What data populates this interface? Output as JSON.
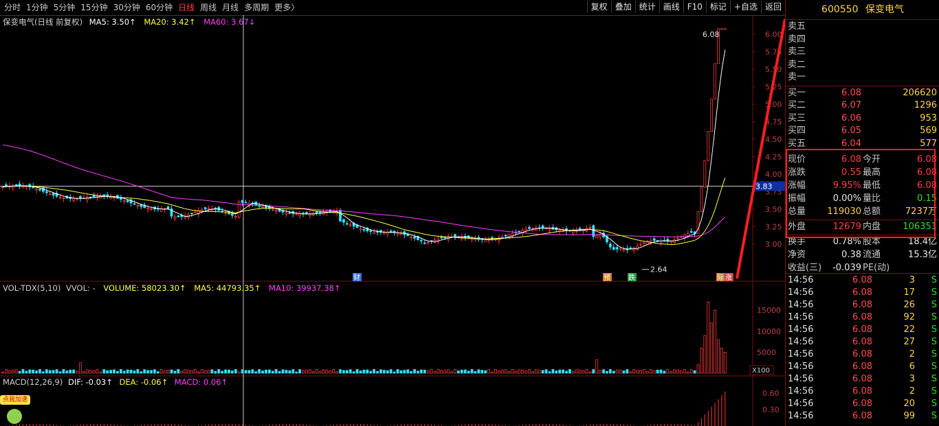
{
  "toolbar": {
    "periods": [
      "分时",
      "1分钟",
      "5分钟",
      "15分钟",
      "30分钟",
      "60分钟",
      "日线",
      "周线",
      "月线",
      "多周期",
      "更多〉"
    ],
    "active_index": 6,
    "tools": [
      "复权",
      "叠加",
      "统计",
      "画线",
      "F10",
      "标记",
      "+自选",
      "返回"
    ]
  },
  "legend_main": {
    "name": "保变电气(日线 前复权)",
    "ma5": "MA5: 3.50↑",
    "ma20": "MA20: 3.42↑",
    "ma60": "MA60: 3.67↓"
  },
  "legend_vol": {
    "name": "VOL-TDX(5,10)",
    "vvol": "VVOL: -",
    "volume": "VOLUME: 58023.30↑",
    "ma5": "MA5: 44793.35↑",
    "ma10": "MA10: 39937.38↑"
  },
  "legend_macd": {
    "name": "MACD(12,26,9)",
    "dif": "DIF: -0.03↑",
    "dea": "DEA: -0.06↑",
    "macd": "MACD: 0.06↑"
  },
  "price_axis": [
    "6.00",
    "5.75",
    "5.50",
    "5.25",
    "5.00",
    "4.75",
    "4.50",
    "4.25",
    "4.00",
    "3.75",
    "3.50",
    "3.25",
    "3.00"
  ],
  "crosshair_price": "3.83",
  "vol_axis": [
    "15000",
    "10000",
    "5000"
  ],
  "vol_unit": "X100",
  "macd_axis": [
    "0.60",
    "0.30"
  ],
  "annotations": {
    "high": "6.08",
    "low": "2.64",
    "markers": [
      "财",
      "预",
      "跌",
      "际",
      "涨"
    ]
  },
  "speed_button": "点我加速",
  "colors": {
    "up": "#ff3b3b",
    "down": "#33e0ff",
    "ma5": "#ffffff",
    "ma20": "#ffff40",
    "ma60": "#ff40ff",
    "panel_border": "#7a1010",
    "highlight_box": "#ff2020"
  },
  "panel": {
    "code": "600550",
    "name": "保变电气",
    "sells": [
      {
        "label": "卖五",
        "price": "",
        "vol": ""
      },
      {
        "label": "卖四",
        "price": "",
        "vol": ""
      },
      {
        "label": "卖三",
        "price": "",
        "vol": ""
      },
      {
        "label": "卖二",
        "price": "",
        "vol": ""
      },
      {
        "label": "卖一",
        "price": "",
        "vol": ""
      }
    ],
    "buys": [
      {
        "label": "买一",
        "price": "6.08",
        "vol": "206620"
      },
      {
        "label": "买二",
        "price": "6.07",
        "vol": "1296"
      },
      {
        "label": "买三",
        "price": "6.06",
        "vol": "953"
      },
      {
        "label": "买四",
        "price": "6.05",
        "vol": "569"
      },
      {
        "label": "买五",
        "price": "6.04",
        "vol": "577"
      }
    ],
    "quotes": [
      {
        "l1": "现价",
        "v1": "6.08",
        "c1": "red",
        "l2": "今开",
        "v2": "6.08",
        "c2": "red"
      },
      {
        "l1": "涨跌",
        "v1": "0.55",
        "c1": "red",
        "l2": "最高",
        "v2": "6.08",
        "c2": "red"
      },
      {
        "l1": "涨幅",
        "v1": "9.95%",
        "c1": "red",
        "l2": "最低",
        "v2": "6.08",
        "c2": "red"
      },
      {
        "l1": "振幅",
        "v1": "0.00%",
        "c1": "white",
        "l2": "量比",
        "v2": "0.15",
        "c2": "green"
      },
      {
        "l1": "总量",
        "v1": "119030",
        "c1": "yellow",
        "l2": "总额",
        "v2": "7237万",
        "c2": "yellow"
      },
      {
        "l1": "外盘",
        "v1": "12679",
        "c1": "red",
        "l2": "内盘",
        "v2": "106351",
        "c2": "green"
      },
      {
        "l1": "换手",
        "v1": "0.78%",
        "c1": "white",
        "l2": "股本",
        "v2": "18.4亿",
        "c2": "white"
      },
      {
        "l1": "净资",
        "v1": "0.38",
        "c1": "white",
        "l2": "流通",
        "v2": "15.3亿",
        "c2": "white"
      },
      {
        "l1": "收益(三)",
        "v1": "-0.039",
        "c1": "white",
        "l2": "PE(动)",
        "v2": "",
        "c2": "white"
      }
    ],
    "ticks": [
      {
        "time": "14:56",
        "price": "6.08",
        "vol": "3",
        "side": "S"
      },
      {
        "time": "14:56",
        "price": "6.08",
        "vol": "17",
        "side": "S"
      },
      {
        "time": "14:56",
        "price": "6.08",
        "vol": "26",
        "side": "S"
      },
      {
        "time": "14:56",
        "price": "6.08",
        "vol": "92",
        "side": "S"
      },
      {
        "time": "14:56",
        "price": "6.08",
        "vol": "22",
        "side": "S"
      },
      {
        "time": "14:56",
        "price": "6.08",
        "vol": "27",
        "side": "S"
      },
      {
        "time": "14:56",
        "price": "6.08",
        "vol": "2",
        "side": "S"
      },
      {
        "time": "14:56",
        "price": "6.08",
        "vol": "6",
        "side": "S"
      },
      {
        "time": "14:56",
        "price": "6.08",
        "vol": "3",
        "side": "S"
      },
      {
        "time": "14:56",
        "price": "6.08",
        "vol": "2",
        "side": "S"
      },
      {
        "time": "14:56",
        "price": "6.08",
        "vol": "20",
        "side": "S"
      },
      {
        "time": "14:56",
        "price": "6.08",
        "vol": "99",
        "side": "S"
      }
    ]
  }
}
